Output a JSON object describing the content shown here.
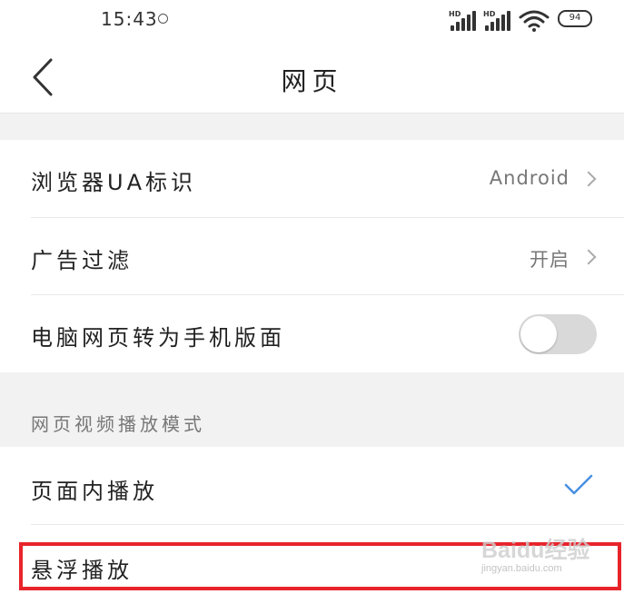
{
  "status_bar": {
    "time": "15:43",
    "signal_label": "HD",
    "battery": "94"
  },
  "header": {
    "title": "网页"
  },
  "settings": {
    "ua": {
      "label": "浏览器UA标识",
      "value": "Android"
    },
    "ad_filter": {
      "label": "广告过滤",
      "value": "开启"
    },
    "desktop_to_mobile": {
      "label": "电脑网页转为手机版面",
      "enabled": false
    }
  },
  "video_section": {
    "title": "网页视频播放模式",
    "options": [
      {
        "label": "页面内播放",
        "selected": true
      },
      {
        "label": "悬浮播放",
        "selected": false
      }
    ]
  },
  "watermark": {
    "brand": "Baidu经验",
    "url": "jingyan.baidu.com"
  },
  "colors": {
    "check": "#4a90e2",
    "highlight": "#e8242b",
    "toggle_off": "#d9d9d9"
  }
}
